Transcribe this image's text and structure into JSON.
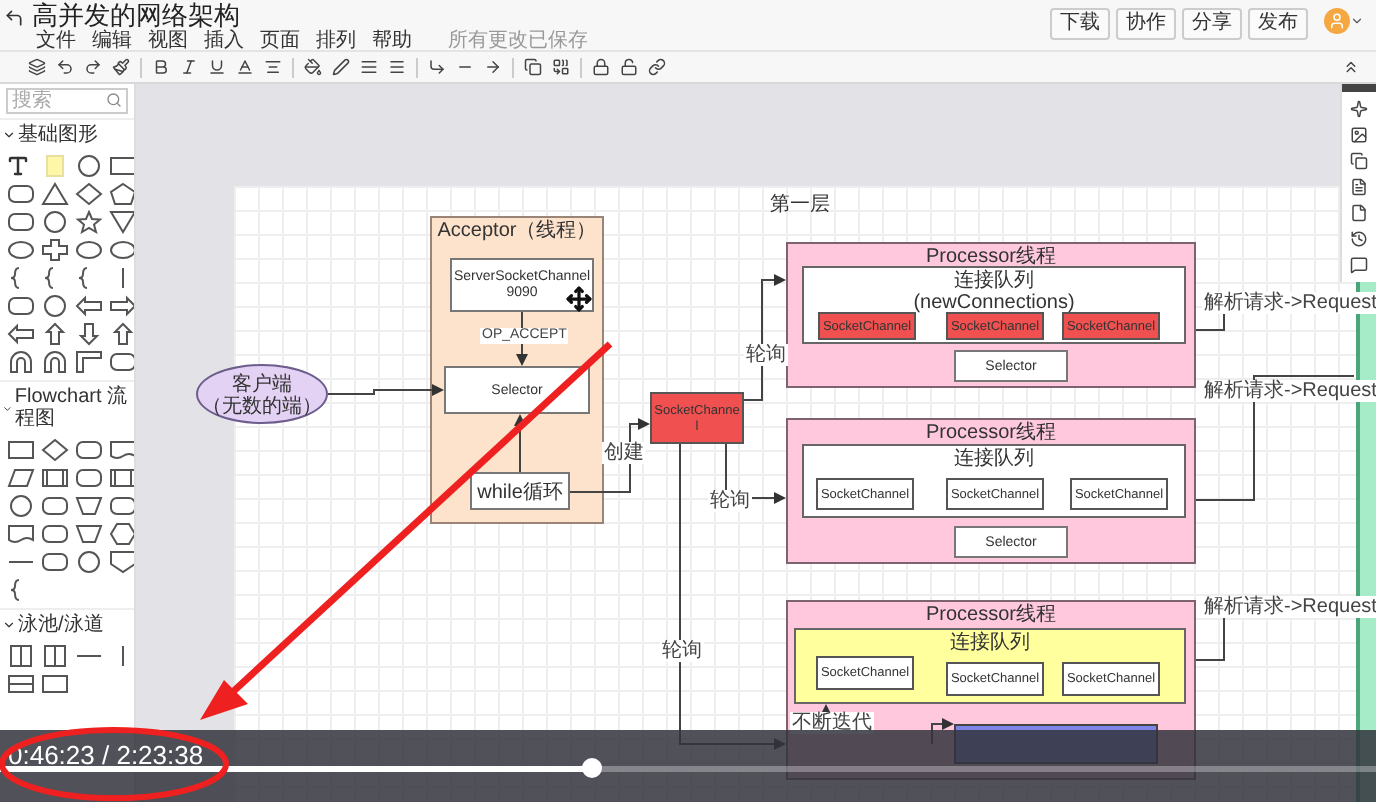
{
  "editor": {
    "title": "高并发的网络架构",
    "menu": [
      "文件",
      "编辑",
      "视图",
      "插入",
      "页面",
      "排列",
      "帮助"
    ],
    "save_status": "所有更改已保存",
    "actions": [
      "下载",
      "协作",
      "分享",
      "发布"
    ]
  },
  "sidebar": {
    "search": {
      "placeholder": "搜索"
    },
    "sections": [
      {
        "title": "基础图形",
        "expanded": true
      },
      {
        "title": "Flowchart 流程图",
        "expanded": true
      },
      {
        "title": "泳池/泳道",
        "expanded": true
      }
    ]
  },
  "diagram": {
    "page_title": "第一层",
    "nodes": [
      {
        "kind": "thread",
        "text": "Acceptor（线程）",
        "children": [
          {
            "kind": "box",
            "lines": [
              "ServerSocketChannel",
              "9090"
            ]
          },
          {
            "kind": "box",
            "text": "Selector"
          },
          {
            "kind": "box",
            "text": "while循环"
          }
        ]
      },
      {
        "kind": "client",
        "lines": [
          "客户端",
          "（无数的端）"
        ]
      },
      {
        "kind": "channel",
        "lines": [
          "SocketChanne",
          "l"
        ],
        "highlighted": true
      },
      {
        "kind": "processor",
        "text": "Processor线程",
        "children": [
          {
            "kind": "queue",
            "lines": [
              "连接队列",
              "(newConnections)"
            ],
            "highlighted": false,
            "children": [
              {
                "kind": "channel",
                "text": "SocketChannel",
                "highlighted": true
              },
              {
                "kind": "channel",
                "text": "SocketChannel",
                "highlighted": true
              },
              {
                "kind": "channel",
                "text": "SocketChannel",
                "highlighted": true
              }
            ]
          },
          {
            "kind": "box",
            "text": "Selector"
          }
        ]
      },
      {
        "kind": "processor",
        "text": "Processor线程",
        "children": [
          {
            "kind": "queue",
            "text": "连接队列",
            "highlighted": false,
            "children": [
              {
                "kind": "channel",
                "text": "SocketChannel",
                "highlighted": false
              },
              {
                "kind": "channel",
                "text": "SocketChannel",
                "highlighted": false
              },
              {
                "kind": "channel",
                "text": "SocketChannel",
                "highlighted": false
              }
            ]
          },
          {
            "kind": "box",
            "text": "Selector"
          }
        ]
      },
      {
        "kind": "processor",
        "text": "Processor线程",
        "children": [
          {
            "kind": "queue",
            "text": "连接队列",
            "highlighted": true,
            "children": [
              {
                "kind": "channel",
                "text": "SocketChannel",
                "highlighted": false
              },
              {
                "kind": "channel",
                "text": "SocketChannel",
                "highlighted": false
              },
              {
                "kind": "channel",
                "text": "SocketChannel",
                "highlighted": false
              }
            ]
          },
          {
            "kind": "block"
          }
        ]
      },
      {
        "kind": "column"
      }
    ],
    "edge_labels": [
      "OP_ACCEPT",
      "创建",
      "轮询",
      "轮询",
      "轮询",
      "解析请求->Request",
      "解析请求->Request",
      "解析请求->Request",
      "不断迭代"
    ]
  },
  "player": {
    "time": "0:46:23 / 2:23:38",
    "level": 0.43
  }
}
